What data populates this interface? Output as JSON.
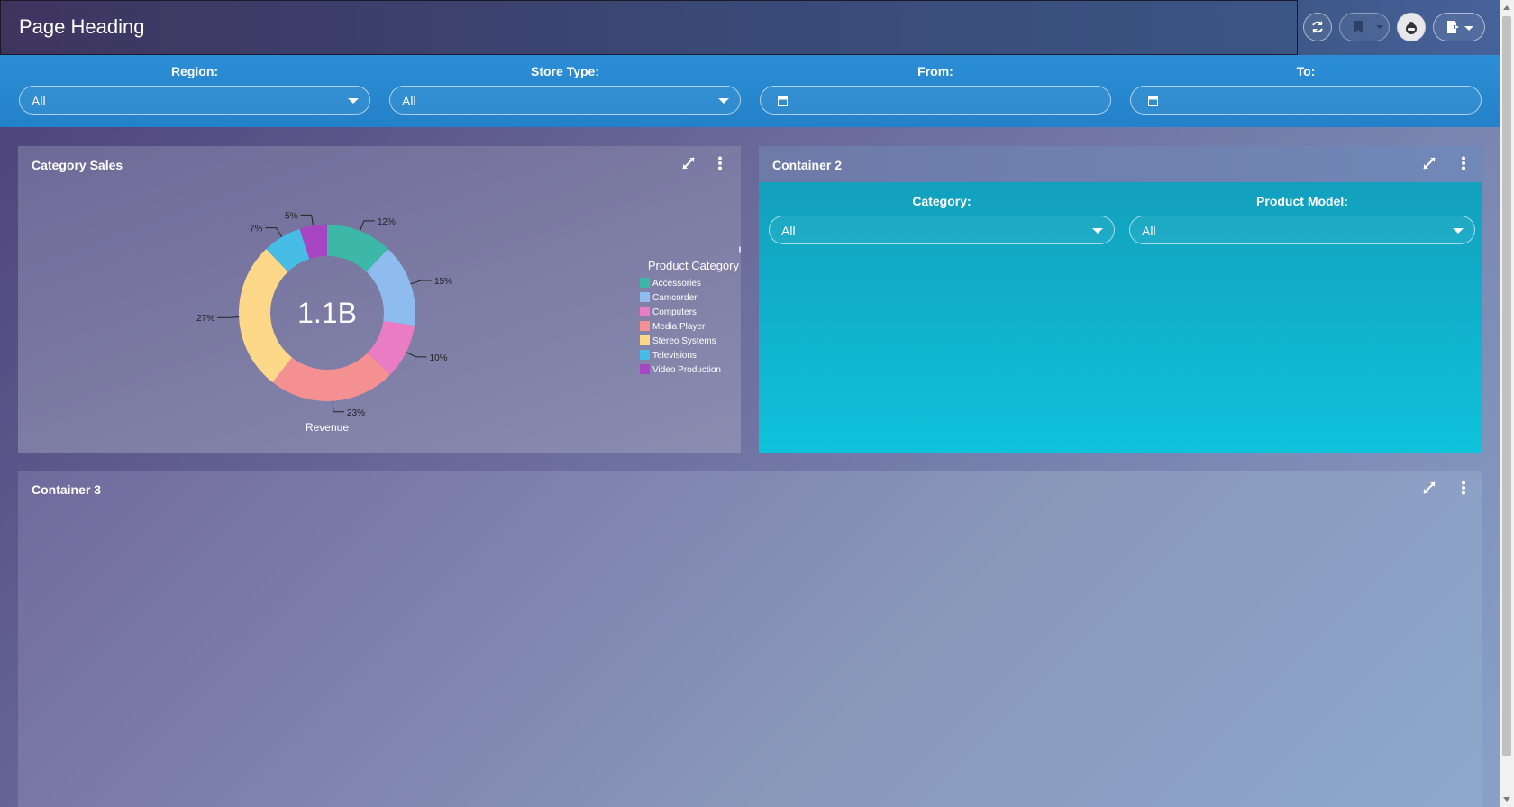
{
  "header": {
    "title": "Page Heading",
    "icons": [
      "refresh-icon",
      "bookmark-icon",
      "chevron-down-icon",
      "user-icon",
      "export-icon",
      "chevron-down-icon"
    ]
  },
  "filters": {
    "region": {
      "label": "Region:",
      "value": "All"
    },
    "store_type": {
      "label": "Store Type:",
      "value": "All"
    },
    "from": {
      "label": "From:",
      "value": ""
    },
    "to": {
      "label": "To:",
      "value": ""
    }
  },
  "panel1": {
    "title": "Category Sales",
    "icons": [
      "expand-icon",
      "more-vertical-icon"
    ]
  },
  "panel2": {
    "title": "Container 2",
    "category": {
      "label": "Category:",
      "value": "All"
    },
    "product_model": {
      "label": "Product Model:",
      "value": "All"
    }
  },
  "panel3": {
    "title": "Container 3"
  },
  "chart_data": {
    "type": "pie",
    "center_label": "1.1B",
    "xlabel": "Revenue",
    "legend_title": "Product Category",
    "legend_position": "right",
    "categories": [
      "Accessories",
      "Camcorder",
      "Computers",
      "Media Player",
      "Stereo Systems",
      "Televisions",
      "Video Production"
    ],
    "values": [
      12,
      15,
      10,
      23,
      27,
      7,
      5
    ],
    "labels": [
      "12%",
      "15%",
      "10%",
      "23%",
      "27%",
      "7%",
      "5%"
    ],
    "colors": [
      "#3db8a8",
      "#8fbcee",
      "#ea7cc4",
      "#f49092",
      "#fed889",
      "#47bce4",
      "#a745c2"
    ]
  }
}
